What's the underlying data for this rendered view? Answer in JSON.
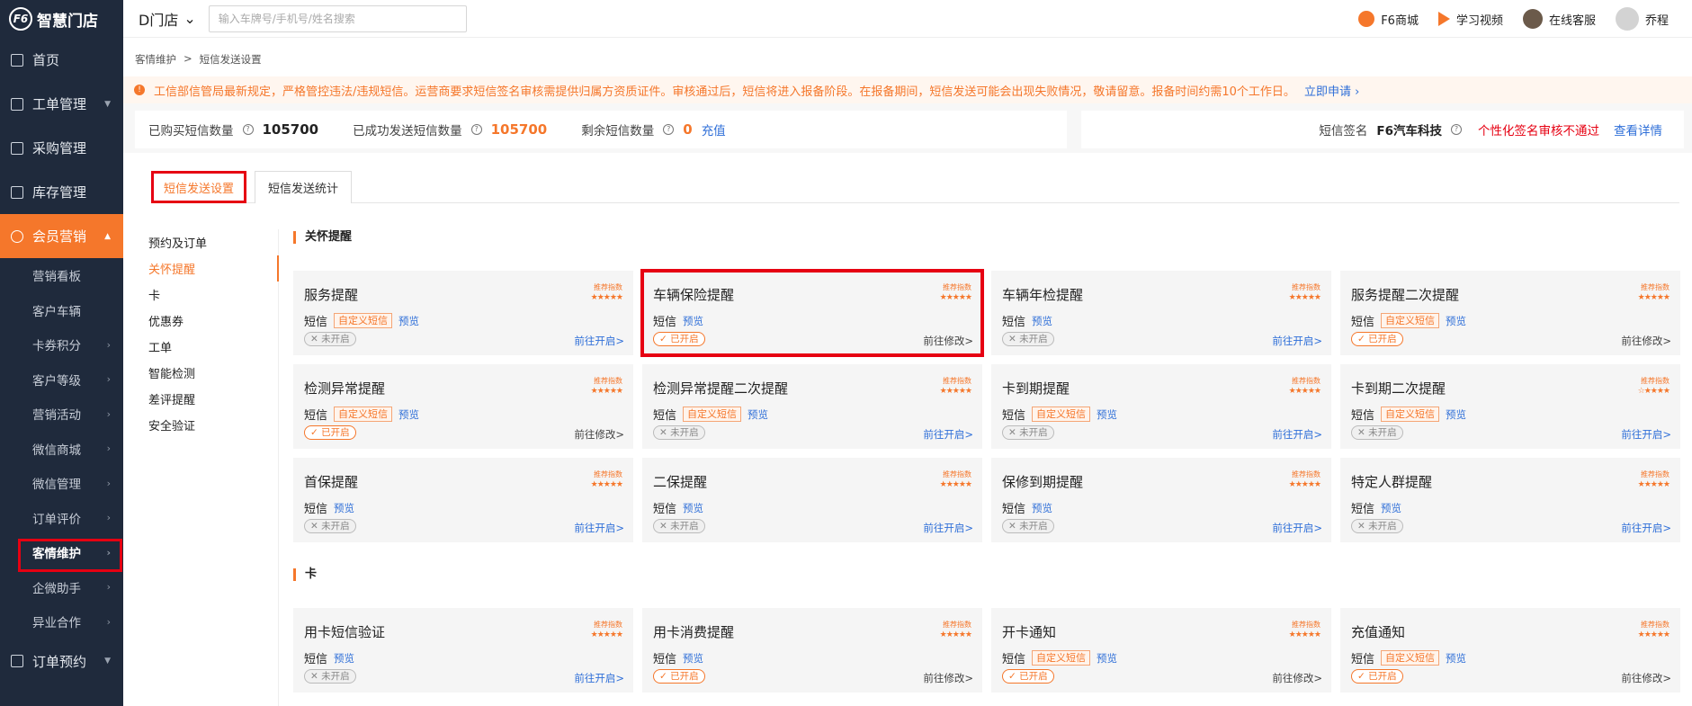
{
  "app": {
    "logo_text": "智慧门店",
    "logo_mark": "F6"
  },
  "sidebar": {
    "nav": [
      {
        "label": "首页",
        "icon": "home-icon",
        "arrow": ""
      },
      {
        "label": "工单管理",
        "icon": "order-icon",
        "arrow": "▼"
      },
      {
        "label": "采购管理",
        "icon": "cart-icon",
        "arrow": ""
      },
      {
        "label": "库存管理",
        "icon": "warehouse-icon",
        "arrow": ""
      },
      {
        "label": "会员营销",
        "icon": "crown-icon",
        "arrow": "▲"
      }
    ],
    "sub_items": [
      {
        "label": "营销看板",
        "arrow": ""
      },
      {
        "label": "客户车辆",
        "arrow": ""
      },
      {
        "label": "卡券积分",
        "arrow": "›"
      },
      {
        "label": "客户等级",
        "arrow": "›"
      },
      {
        "label": "营销活动",
        "arrow": "›"
      },
      {
        "label": "微信商城",
        "arrow": "›"
      },
      {
        "label": "微信管理",
        "arrow": "›"
      },
      {
        "label": "订单评价",
        "arrow": "›"
      },
      {
        "label": "客情维护",
        "arrow": "›"
      },
      {
        "label": "企微助手",
        "arrow": "›"
      },
      {
        "label": "异业合作",
        "arrow": "›"
      }
    ],
    "bottom_nav": {
      "label": "订单预约",
      "arrow": "▼"
    }
  },
  "header": {
    "store": "D门店",
    "search_placeholder": "输入车牌号/手机号/姓名搜索",
    "links": [
      "F6商城",
      "学习视频",
      "在线客服"
    ],
    "user": "乔程"
  },
  "breadcrumb": [
    "客情维护",
    ">",
    "短信发送设置"
  ],
  "notice": {
    "text": "工信部信管局最新规定，严格管控违法/违规短信。运营商要求短信签名审核需提供归属方资质证件。审核通过后，短信将进入报备阶段。在报备期间，短信发送可能会出现失败情况，敬请留意。报备时间约需10个工作日。",
    "apply": "立即申请 ›"
  },
  "stats": {
    "bought_label": "已购买短信数量",
    "bought": "105700",
    "sent_label": "已成功发送短信数量",
    "sent": "105700",
    "remain_label": "剩余短信数量",
    "remain": "0",
    "recharge": "充值",
    "sig_label": "短信签名",
    "sig_value": "F6汽车科技",
    "sig_status": "个性化签名审核不通过",
    "sig_detail": "查看详情"
  },
  "tabs": [
    "短信发送设置",
    "短信发送统计"
  ],
  "categories": [
    "预约及订单",
    "关怀提醒",
    "卡",
    "优惠券",
    "工单",
    "智能检测",
    "差评提醒",
    "安全验证"
  ],
  "sections": {
    "care": "关怀提醒",
    "card": "卡"
  },
  "card_common": {
    "rec_label": "推荐指数",
    "sms": "短信",
    "custom_tag": "自定义短信",
    "preview": "预览",
    "status_on": "✓ 已开启",
    "status_off": "✕ 未开启",
    "go_open": "前往开启>",
    "go_edit": "前往修改>"
  },
  "cards": [
    {
      "title": "服务提醒",
      "stars": "★★★★★",
      "custom": true,
      "on": false
    },
    {
      "title": "车辆保险提醒",
      "stars": "★★★★★",
      "custom": false,
      "on": true
    },
    {
      "title": "车辆年检提醒",
      "stars": "★★★★★",
      "custom": false,
      "on": false
    },
    {
      "title": "服务提醒二次提醒",
      "stars": "★★★★★",
      "custom": true,
      "on": true
    },
    {
      "title": "检测异常提醒",
      "stars": "★★★★★",
      "custom": true,
      "on": true
    },
    {
      "title": "检测异常提醒二次提醒",
      "stars": "★★★★★",
      "custom": true,
      "on": false
    },
    {
      "title": "卡到期提醒",
      "stars": "★★★★★",
      "custom": true,
      "on": false
    },
    {
      "title": "卡到期二次提醒",
      "stars": "☆★★★★",
      "custom": true,
      "on": false
    },
    {
      "title": "首保提醒",
      "stars": "★★★★★",
      "custom": false,
      "on": false
    },
    {
      "title": "二保提醒",
      "stars": "★★★★★",
      "custom": false,
      "on": false
    },
    {
      "title": "保修到期提醒",
      "stars": "★★★★★",
      "custom": false,
      "on": false
    },
    {
      "title": "特定人群提醒",
      "stars": "★★★★★",
      "custom": false,
      "on": false
    },
    {
      "title": "用卡短信验证",
      "stars": "★★★★★",
      "custom": false,
      "on": false
    },
    {
      "title": "用卡消费提醒",
      "stars": "★★★★★",
      "custom": false,
      "on": true
    },
    {
      "title": "开卡通知",
      "stars": "★★★★★",
      "custom": true,
      "on": true
    },
    {
      "title": "充值通知",
      "stars": "★★★★★",
      "custom": true,
      "on": true
    }
  ]
}
